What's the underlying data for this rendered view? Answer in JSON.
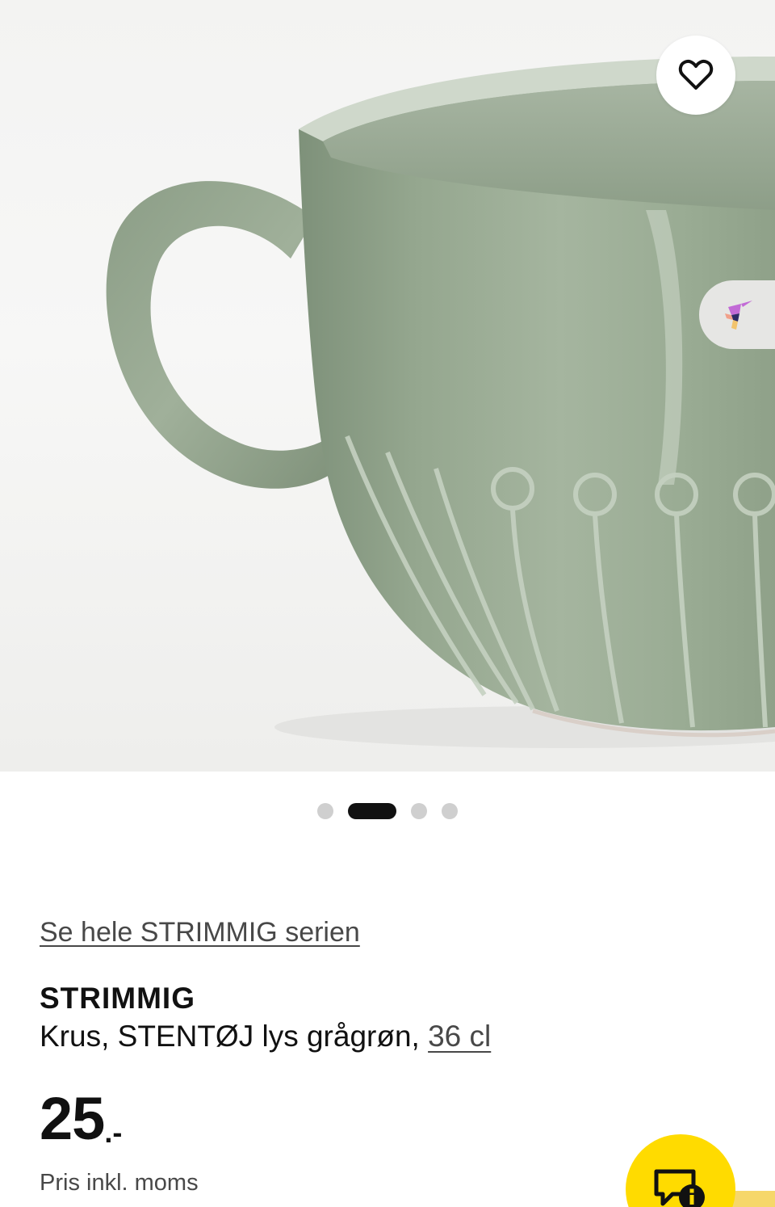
{
  "favorite": {
    "icon": "heart-outline-icon"
  },
  "ar_view": {
    "icon": "hummingbird-icon"
  },
  "carousel": {
    "total": 4,
    "active_index": 1
  },
  "product": {
    "series_link": "Se hele STRIMMIG serien",
    "name": "STRIMMIG",
    "description": "Krus, STENTØJ lys grågrøn,",
    "size_link": "36 cl",
    "price_integer": "25",
    "price_suffix": ".-",
    "vat_note": "Pris inkl. moms"
  },
  "chat": {
    "icon": "chat-info-icon"
  },
  "colors": {
    "accent_yellow": "#ffdb00",
    "mug_green": "#93a58c",
    "text_primary": "#111111",
    "text_secondary": "#484848"
  }
}
